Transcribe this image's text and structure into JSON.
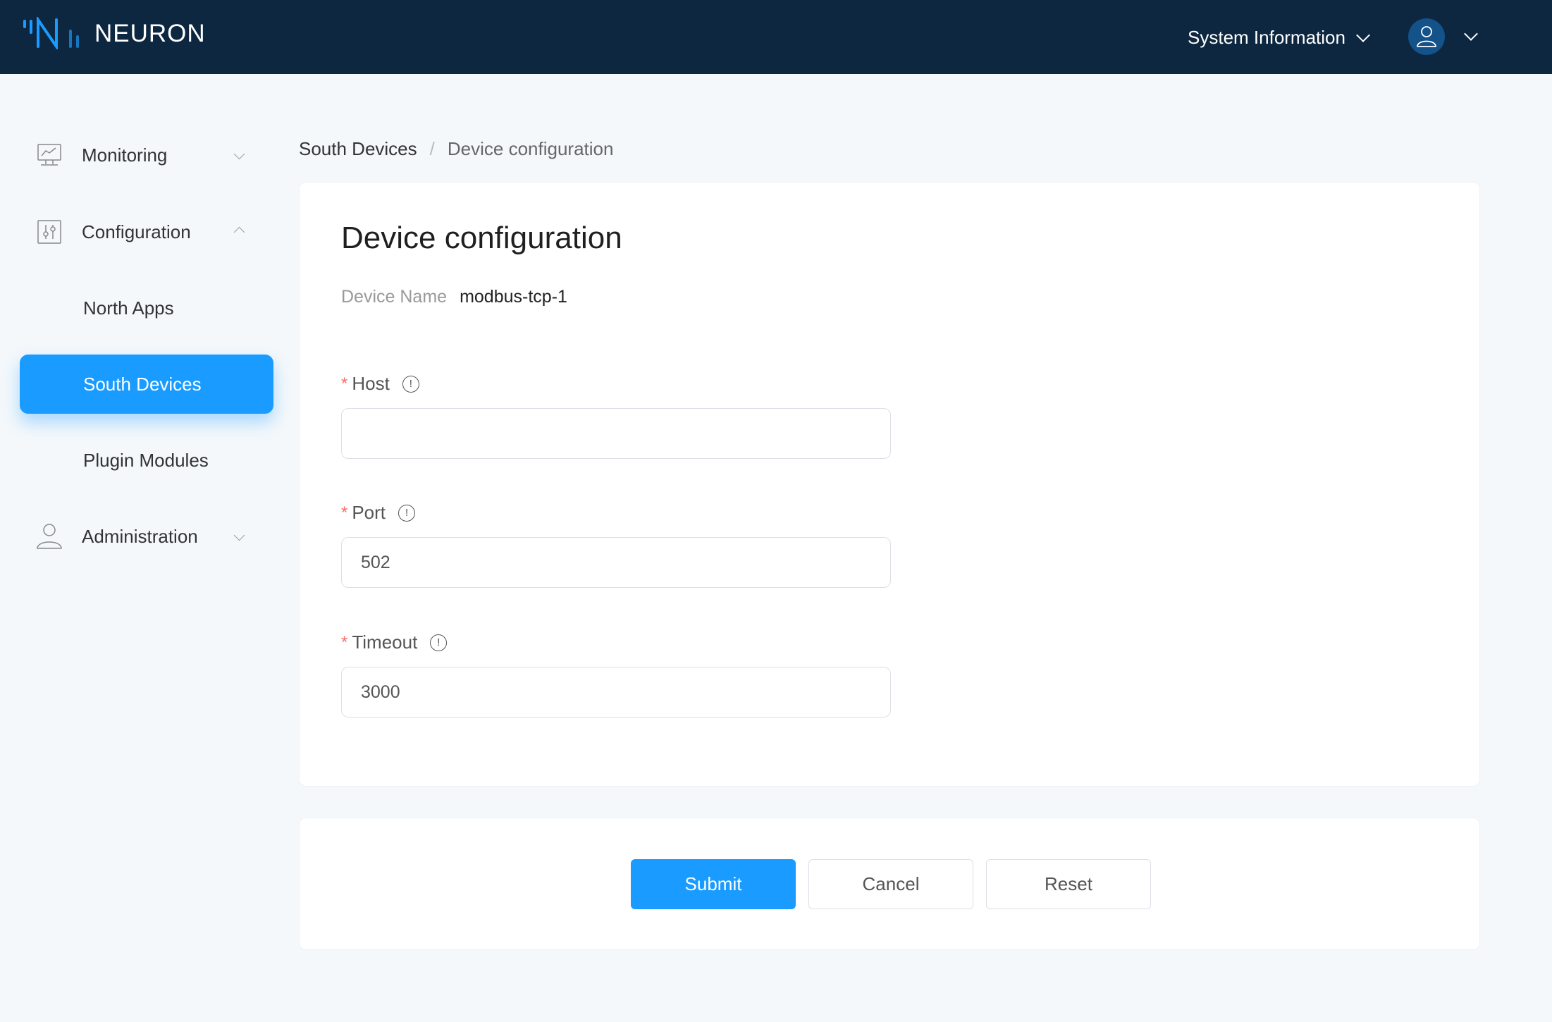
{
  "header": {
    "brand": "NEURON",
    "system_info_label": "System Information",
    "avatar_icon": "user-icon",
    "logo_color": "#1a9bff",
    "background": "#0d2740"
  },
  "sidebar": {
    "items": [
      {
        "label": "Monitoring",
        "icon": "monitor-chart-icon",
        "expanded": false
      },
      {
        "label": "Configuration",
        "icon": "sliders-icon",
        "expanded": true,
        "children": [
          {
            "label": "North Apps",
            "active": false
          },
          {
            "label": "South Devices",
            "active": true
          },
          {
            "label": "Plugin Modules",
            "active": false
          }
        ]
      },
      {
        "label": "Administration",
        "icon": "user-icon",
        "expanded": false
      }
    ],
    "active_color": "#1a9bff"
  },
  "breadcrumb": {
    "parent": "South Devices",
    "separator": "/",
    "current": "Device configuration"
  },
  "form": {
    "title": "Device configuration",
    "device_name_label": "Device Name",
    "device_name_value": "modbus-tcp-1",
    "required_mark": "*",
    "fields": [
      {
        "label": "Host",
        "value": "",
        "required": true,
        "info_icon": "info-circle-icon"
      },
      {
        "label": "Port",
        "value": "502",
        "required": true,
        "info_icon": "info-circle-icon"
      },
      {
        "label": "Timeout",
        "value": "3000",
        "required": true,
        "info_icon": "info-circle-icon"
      }
    ]
  },
  "actions": {
    "submit": "Submit",
    "cancel": "Cancel",
    "reset": "Reset"
  }
}
